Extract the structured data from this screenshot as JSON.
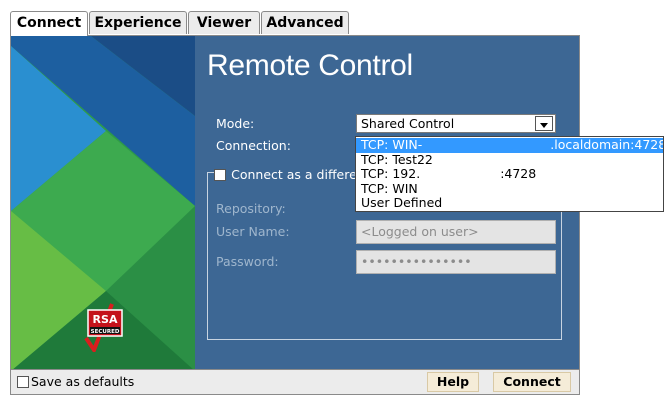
{
  "tabs": [
    {
      "label": "Connect",
      "active": true
    },
    {
      "label": "Experience",
      "active": false
    },
    {
      "label": "Viewer",
      "active": false
    },
    {
      "label": "Advanced",
      "active": false
    }
  ],
  "panel": {
    "title": "Remote Control",
    "mode_label": "Mode:",
    "mode_value": "Shared Control",
    "connection_label": "Connection:",
    "different_user_label": "Connect as a differe",
    "different_user_checked": false,
    "repository_label": "Repository:",
    "username_label": "User Name:",
    "username_value": "<Logged on user>",
    "password_label": "Password:",
    "password_value": "•••••••••••••••"
  },
  "connection_dropdown": {
    "items": [
      {
        "label": "TCP: WIN-",
        "redacted": true,
        "suffix": ".localdomain:4728",
        "selected": true
      },
      {
        "label": "TCP: Test22",
        "selected": false
      },
      {
        "label": "TCP: 192.",
        "redacted": true,
        "suffix": ":4728",
        "selected": false
      },
      {
        "label": "TCP: WIN",
        "redacted": true,
        "suffix": "",
        "selected": false
      },
      {
        "label": "User Defined",
        "selected": false
      }
    ]
  },
  "logo": {
    "brand": "RSA",
    "subtext": "SECURED"
  },
  "footer": {
    "save_defaults_label": "Save as defaults",
    "save_defaults_checked": false,
    "help_label": "Help",
    "connect_label": "Connect"
  },
  "colors": {
    "panel_blue": "#3d6794",
    "selection_blue": "#3399ff",
    "button_bg": "#f5ecd8"
  }
}
